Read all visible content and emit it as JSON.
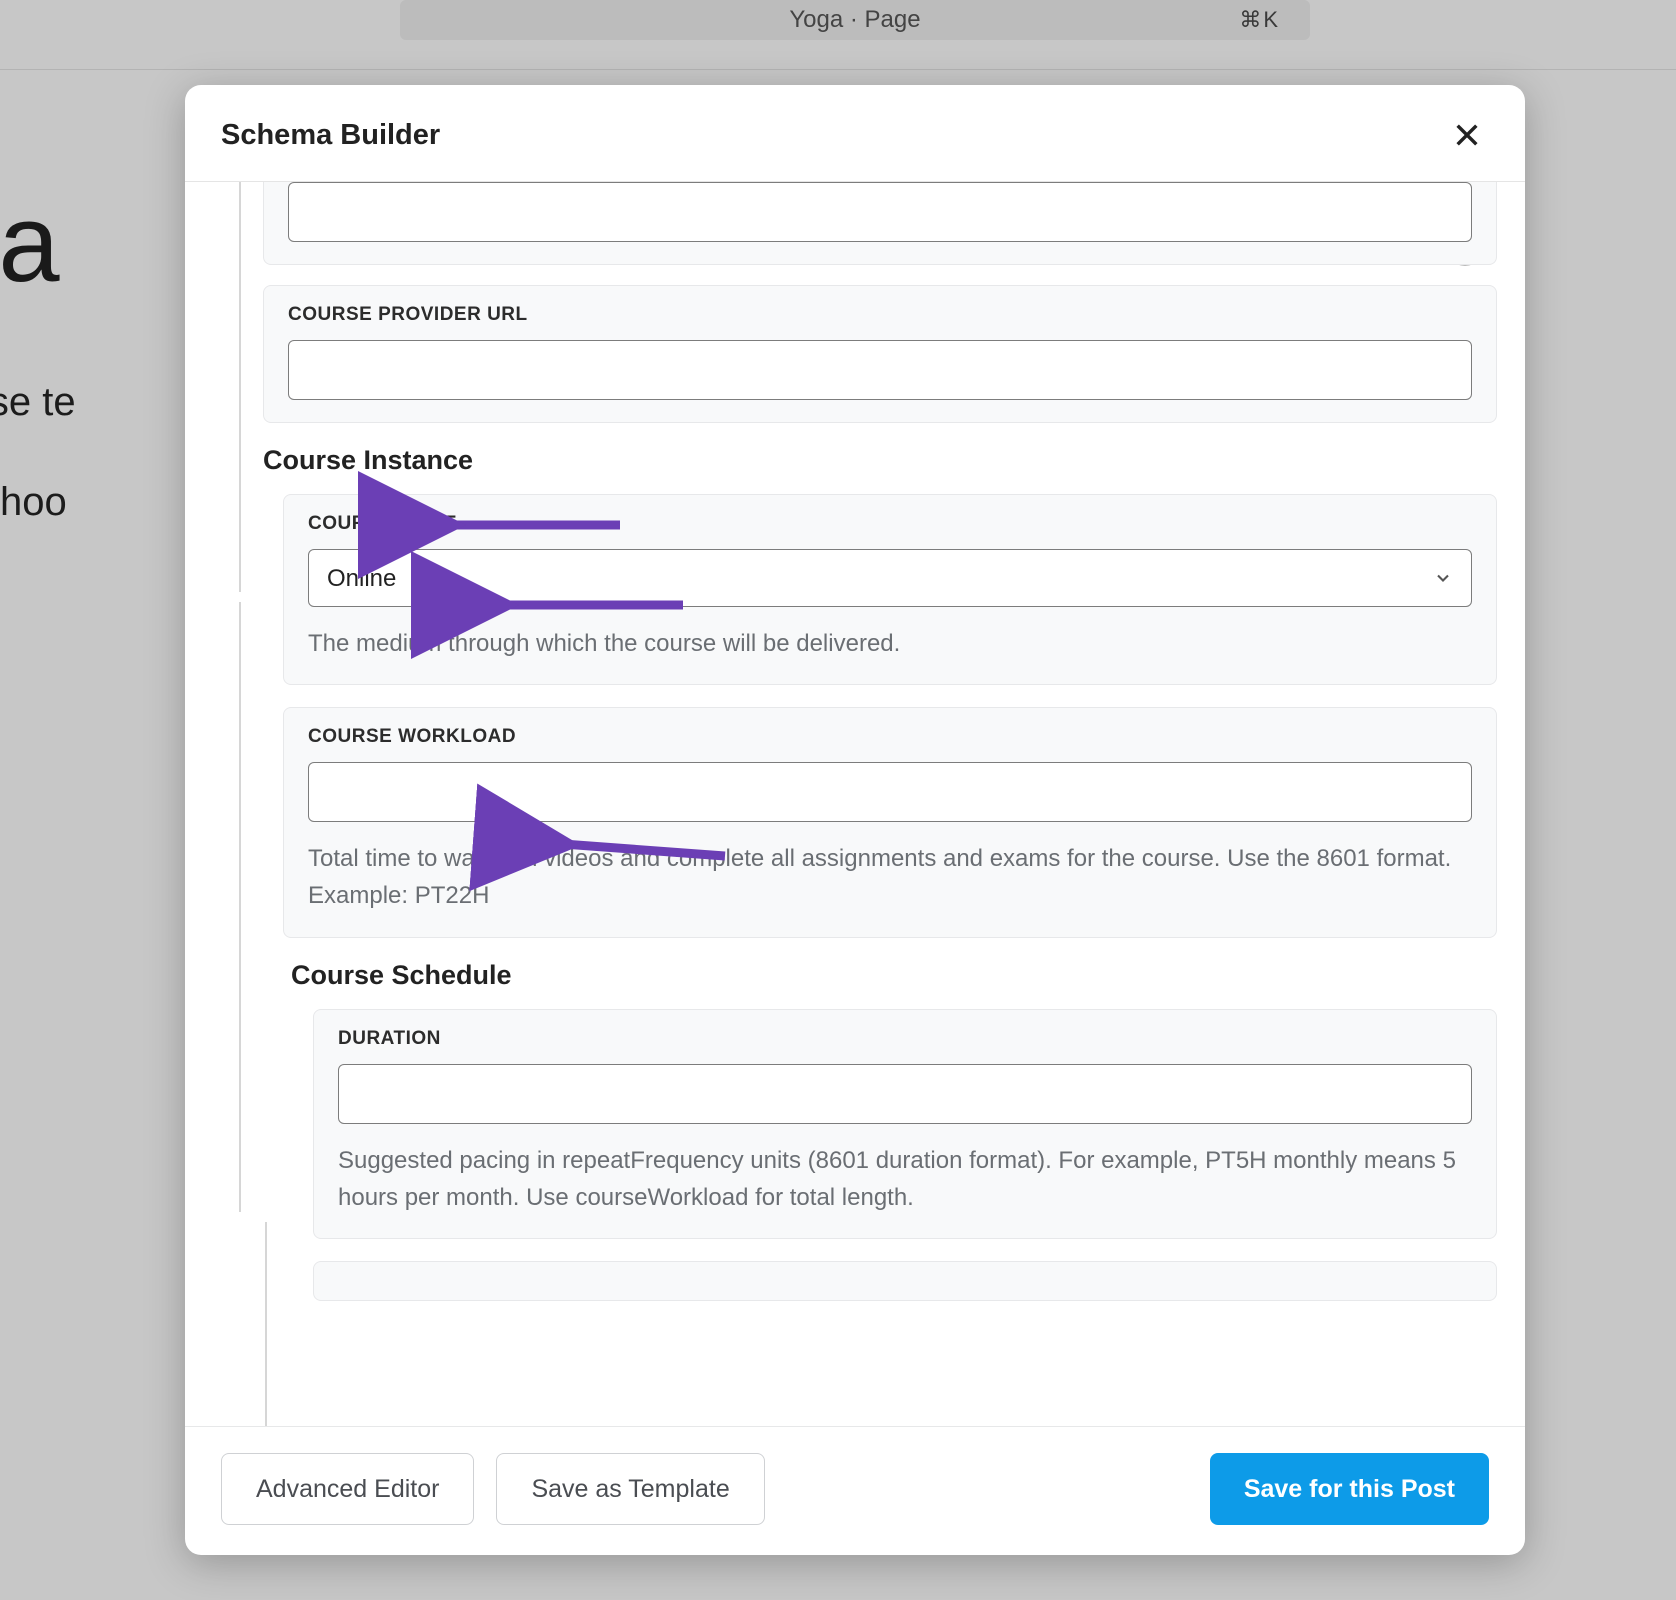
{
  "background": {
    "search_text": "Yoga · Page",
    "search_shortcut": "⌘K",
    "page_title_fragment": "oga",
    "line1_fragment": "s course te",
    "line2_fragment": "e / to choo"
  },
  "modal": {
    "title": "Schema Builder",
    "info_badge": "i",
    "fields": {
      "course_provider_url": {
        "label": "COURSE PROVIDER URL",
        "value": ""
      },
      "course_instance_heading": "Course Instance",
      "course_mode": {
        "label": "COURSE MODE",
        "selected": "Online",
        "help": "The medium through which the course will be delivered."
      },
      "course_workload": {
        "label": "COURSE WORKLOAD",
        "value": "",
        "help": "Total time to watch all videos and complete all assignments and exams for the course. Use the 8601 format. Example: PT22H"
      },
      "course_schedule_heading": "Course Schedule",
      "duration": {
        "label": "DURATION",
        "value": "",
        "help": "Suggested pacing in repeatFrequency units (8601 duration format). For example, PT5H monthly means 5 hours per month. Use courseWorkload for total length."
      }
    },
    "footer": {
      "advanced": "Advanced Editor",
      "save_template": "Save as Template",
      "save_post": "Save for this Post"
    }
  }
}
